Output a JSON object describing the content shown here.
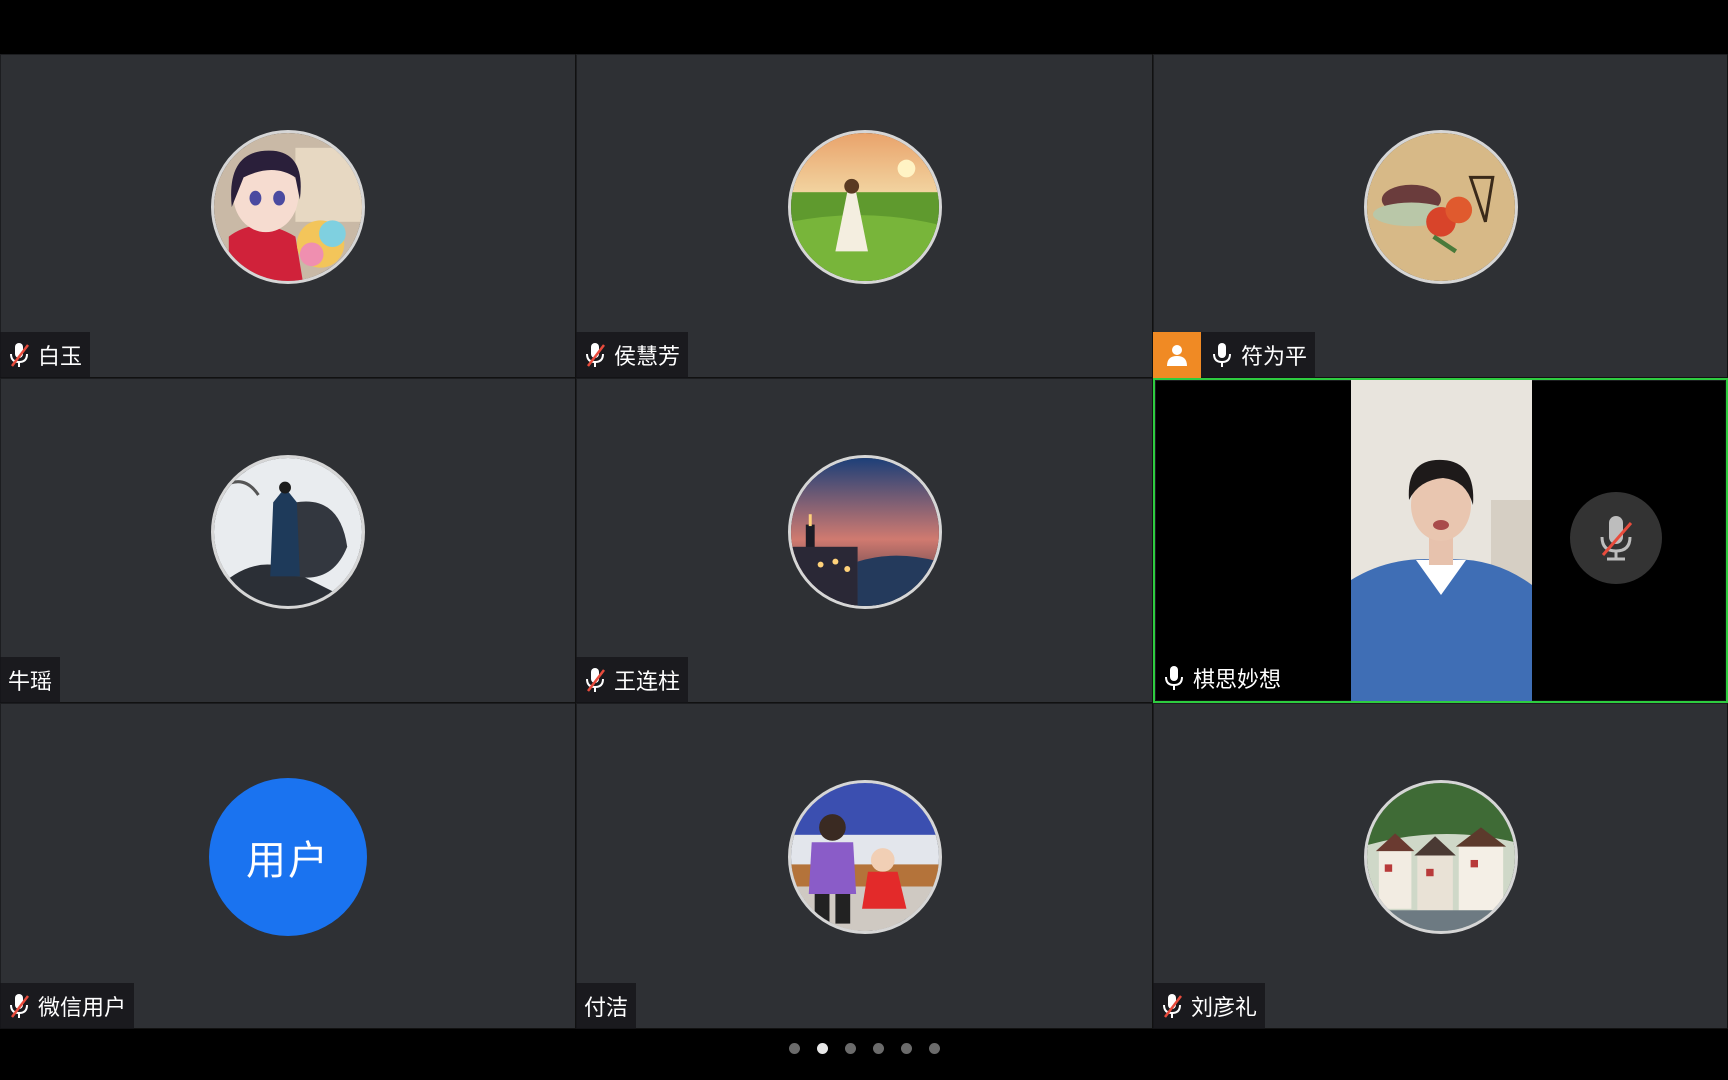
{
  "participants": [
    {
      "name": "白玉",
      "mic": "muted",
      "avatar_icon": "anime-girl-avatar"
    },
    {
      "name": "侯慧芳",
      "mic": "muted",
      "avatar_icon": "grassland-sunset-avatar"
    },
    {
      "name": "符为平",
      "mic": "on",
      "host": true,
      "avatar_icon": "fruit-painting-avatar"
    },
    {
      "name": "牛瑶",
      "mic": "none",
      "avatar_icon": "ink-warrior-avatar"
    },
    {
      "name": "王连柱",
      "mic": "muted",
      "avatar_icon": "city-night-avatar"
    },
    {
      "name": "棋思妙想",
      "mic": "on",
      "video": true,
      "speaking": true
    },
    {
      "name": "微信用户",
      "mic": "muted",
      "avatar_text": "用户"
    },
    {
      "name": "付洁",
      "mic": "none",
      "avatar_icon": "kids-photo-avatar"
    },
    {
      "name": "刘彦礼",
      "mic": "muted",
      "avatar_icon": "village-houses-avatar"
    }
  ],
  "pagination": {
    "total_pages": 6,
    "current_page": 2
  },
  "colors": {
    "tile_bg": "#2e3034",
    "muted_mic": "#e84b3c",
    "host_badge": "#f08a24",
    "active_speaker_border": "#2ecc40",
    "text_avatar_bg": "#1a73f0"
  }
}
